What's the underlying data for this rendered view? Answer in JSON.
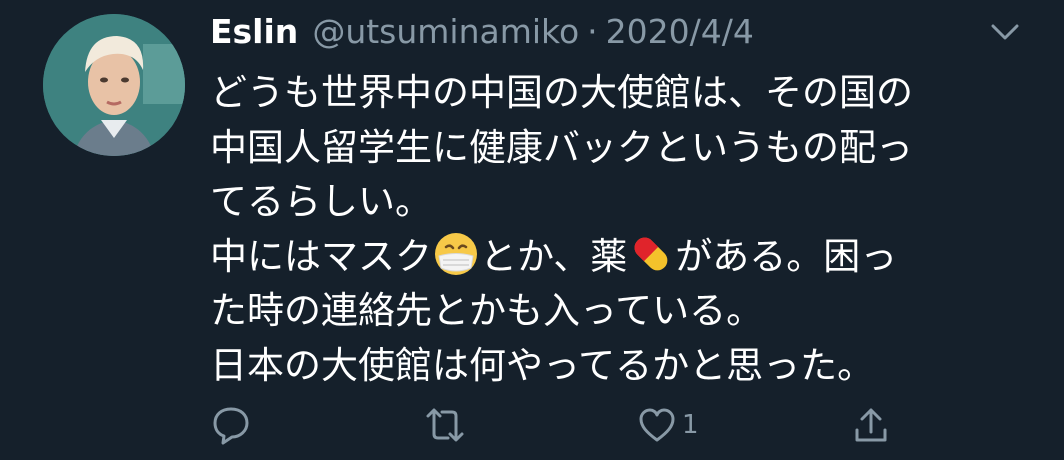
{
  "tweet": {
    "author_name": "Eslin",
    "handle": "@utsuminamiko",
    "separator": "·",
    "date": "2020/4/4",
    "text_lines": {
      "l1": "どうも世界中の中国の大使館は、その国の",
      "l2": "中国人留学生に健康バックというもの配っ",
      "l3": "てるらしい。",
      "l4a": "中にはマスク",
      "l4b": "とか、薬",
      "l4c": "がある。困っ",
      "l5": "た時の連絡先とかも入っている。",
      "l6": "日本の大使館は何やってるかと思った。"
    },
    "emojis": [
      "face-with-medical-mask",
      "pill"
    ]
  },
  "actions": {
    "reply_icon": "speech-bubble-icon",
    "retweet_icon": "retweet-arrows-icon",
    "like_icon": "heart-outline-icon",
    "like_count": "1",
    "share_icon": "share-upload-icon"
  },
  "colors": {
    "background": "#15202b",
    "text": "#ffffff",
    "secondary": "#8899a6"
  }
}
